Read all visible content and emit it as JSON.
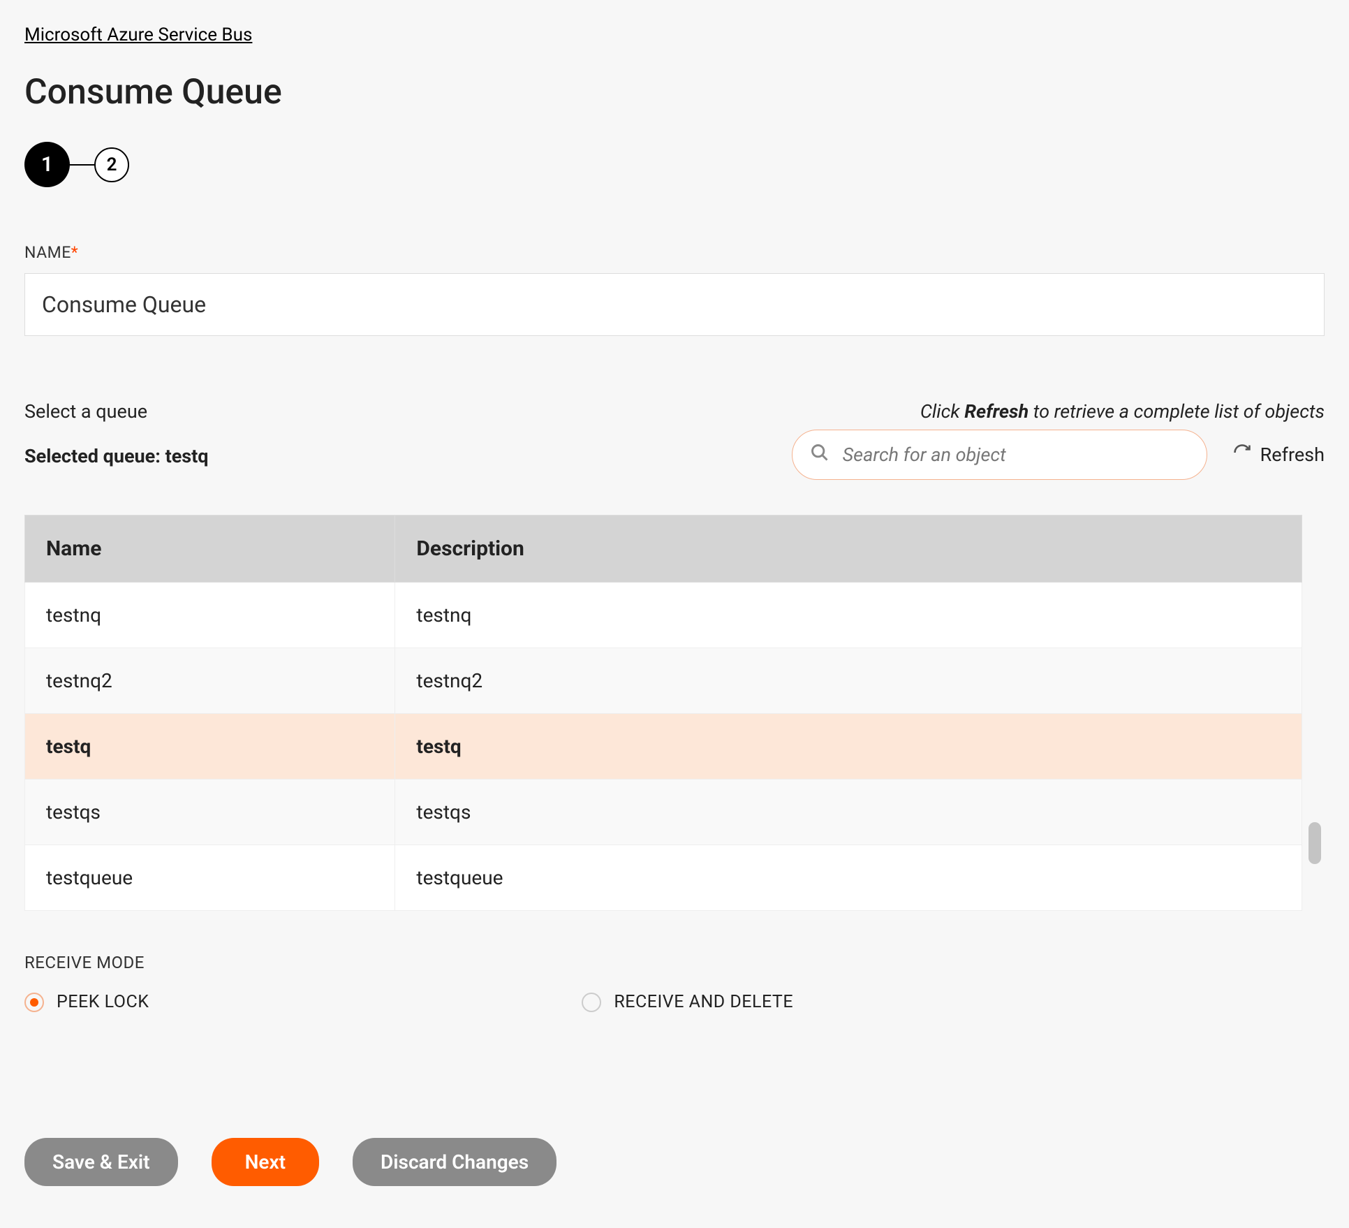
{
  "breadcrumb": {
    "label": "Microsoft Azure Service Bus"
  },
  "page": {
    "title": "Consume Queue"
  },
  "stepper": {
    "steps": [
      "1",
      "2"
    ]
  },
  "nameField": {
    "label": "NAME",
    "value": "Consume Queue"
  },
  "queueSelect": {
    "label": "Select a queue",
    "selectedPrefix": "Selected queue: ",
    "selectedValue": "testq",
    "hintPrefix": "Click ",
    "hintBold": "Refresh",
    "hintSuffix": " to retrieve a complete list of objects",
    "searchPlaceholder": "Search for an object",
    "refreshLabel": "Refresh"
  },
  "table": {
    "headers": {
      "name": "Name",
      "description": "Description"
    },
    "rows": [
      {
        "name": "testnq",
        "description": "testnq",
        "selected": false
      },
      {
        "name": "testnq2",
        "description": "testnq2",
        "selected": false
      },
      {
        "name": "testq",
        "description": "testq",
        "selected": true
      },
      {
        "name": "testqs",
        "description": "testqs",
        "selected": false
      },
      {
        "name": "testqueue",
        "description": "testqueue",
        "selected": false
      }
    ]
  },
  "receiveMode": {
    "label": "RECEIVE MODE",
    "options": [
      {
        "label": "PEEK LOCK",
        "selected": true
      },
      {
        "label": "RECEIVE AND DELETE",
        "selected": false
      }
    ]
  },
  "buttons": {
    "saveExit": "Save & Exit",
    "next": "Next",
    "discard": "Discard Changes"
  }
}
